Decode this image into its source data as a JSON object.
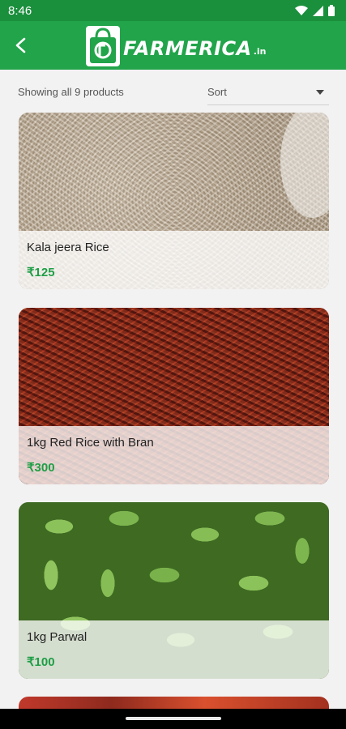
{
  "status_bar": {
    "time": "8:46"
  },
  "header": {
    "brand": "FARMERICA",
    "brand_suffix": ".in"
  },
  "filter": {
    "count_text": "Showing all 9 products",
    "sort_value": "Sort"
  },
  "products": [
    {
      "name": "Kala jeera Rice",
      "price": "₹125"
    },
    {
      "name": "1kg Red Rice with Bran",
      "price": "₹300"
    },
    {
      "name": "1kg Parwal",
      "price": "₹100"
    }
  ],
  "colors": {
    "brand_green": "#21a44a",
    "status_green": "#1a8f3c",
    "price_green": "#1f9e46"
  }
}
